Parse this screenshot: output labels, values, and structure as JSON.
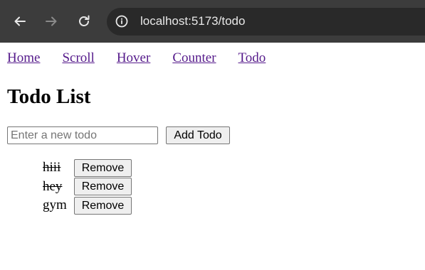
{
  "browser": {
    "back_icon": "back-arrow-icon",
    "forward_icon": "forward-arrow-icon",
    "reload_icon": "reload-icon",
    "site_info_icon": "site-info-icon",
    "url": "localhost:5173/todo",
    "colors": {
      "toolbar": "#3c3c3c",
      "omnibox": "#292929",
      "icon": "#e8e8e8",
      "icon_disabled": "#8a8a8a"
    }
  },
  "nav": {
    "links": [
      {
        "label": "Home"
      },
      {
        "label": "Scroll"
      },
      {
        "label": "Hover"
      },
      {
        "label": "Counter"
      },
      {
        "label": "Todo"
      }
    ],
    "link_color": "#551a8b"
  },
  "page": {
    "title": "Todo List",
    "input": {
      "value": "",
      "placeholder": "Enter a new todo"
    },
    "add_button": "Add Todo",
    "todos": [
      {
        "text": "hiii",
        "completed": true,
        "remove_label": "Remove"
      },
      {
        "text": "hey",
        "completed": true,
        "remove_label": "Remove"
      },
      {
        "text": "gym",
        "completed": false,
        "remove_label": "Remove"
      }
    ]
  }
}
